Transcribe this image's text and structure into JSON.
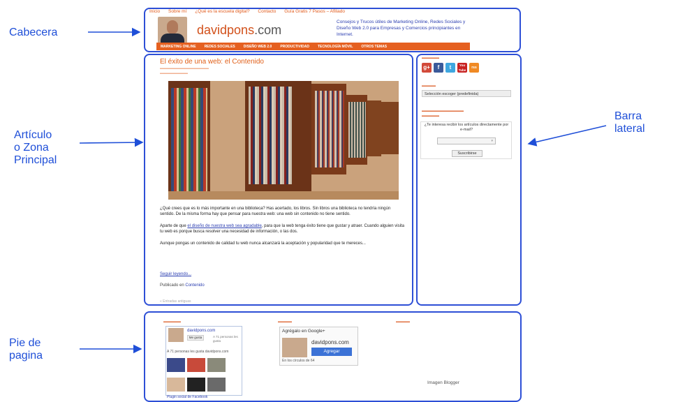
{
  "annotations": {
    "header": "Cabecera",
    "article": [
      "Artículo",
      "o Zona",
      "Principal"
    ],
    "sidebar": [
      "Barra",
      "lateral"
    ],
    "footer": [
      "Pie de",
      "pagina"
    ]
  },
  "colors": {
    "annotation": "#1f4fd8",
    "frame": "#2d4fd6",
    "brand_orange": "#e56020",
    "link_blue": "#2a3db0"
  },
  "header": {
    "nav": [
      "Inicio",
      "Sobre mí",
      "¿Qué es la escuela digital?",
      "Contacto",
      "Guía Gratis 7 Pasos – Afiliado"
    ],
    "logo_prefix": "davidpons",
    "logo_suffix": ".com",
    "tagline": "Consejos y Trucos útiles de Marketing Online, Redes Sociales y Diseño Web 2.0 para Empresas y Comercios principiantes en Internet.",
    "menu": [
      "MARKETING ONLINE",
      "REDES SOCIALES",
      "DISEÑO WEB 2.0",
      "PRODUCTIVIDAD",
      "TECNOLOGÍA MÓVIL",
      "OTROS TEMAS"
    ]
  },
  "article": {
    "title": "El éxito de una web: el Contenido",
    "paragraph1": "¿Qué crees que es lo más importante en una biblioteca? Has acertado, los libros. Sin libros una biblioteca no tendría ningún sentido. De la misma forma hay que pensar para nuestra web: una web sin contenido no tiene sentido.",
    "paragraph2_before": "Aparte de que ",
    "paragraph2_link": "el diseño de nuestra web sea agradable",
    "paragraph2_after": ", para que la web tenga éxito tiene que gustar y atraer. Cuando alguien visita tu web es porque busca resolver una necesidad de información, o las dos.",
    "paragraph3": "Aunque pongas un contenido de calidad tu web nunca alcanzará la aceptación y popularidad que te mereces...",
    "read_more": "Seguir leyendo...",
    "posted_prefix": "Publicado en",
    "posted_link": "Contenido",
    "older": "« Entradas antiguas"
  },
  "sidebar": {
    "social_icons": [
      "g+",
      "f",
      "t",
      "You Tube",
      "rss"
    ],
    "category_select": "Selección escoger (predefinida)",
    "subscribe_text": "¿Te interesa recibir los artículos directamente por e-mail?",
    "subscribe_button": "Suscribirse"
  },
  "footer": {
    "fb_name": "davidpons.com",
    "fb_like": "Me gusta",
    "fb_count": "A 71 personas les gusta",
    "fb_people": "A 71 personas les gusta davidpons.com",
    "fb_plugin": "Plugin social de Facebook",
    "gplus_title": "Agrégalo en Google+",
    "gplus_name": "davidpons.com",
    "gplus_button": "Agregar",
    "gplus_count": "En los círculos de 64",
    "blogger": "Imagen Blogger"
  }
}
